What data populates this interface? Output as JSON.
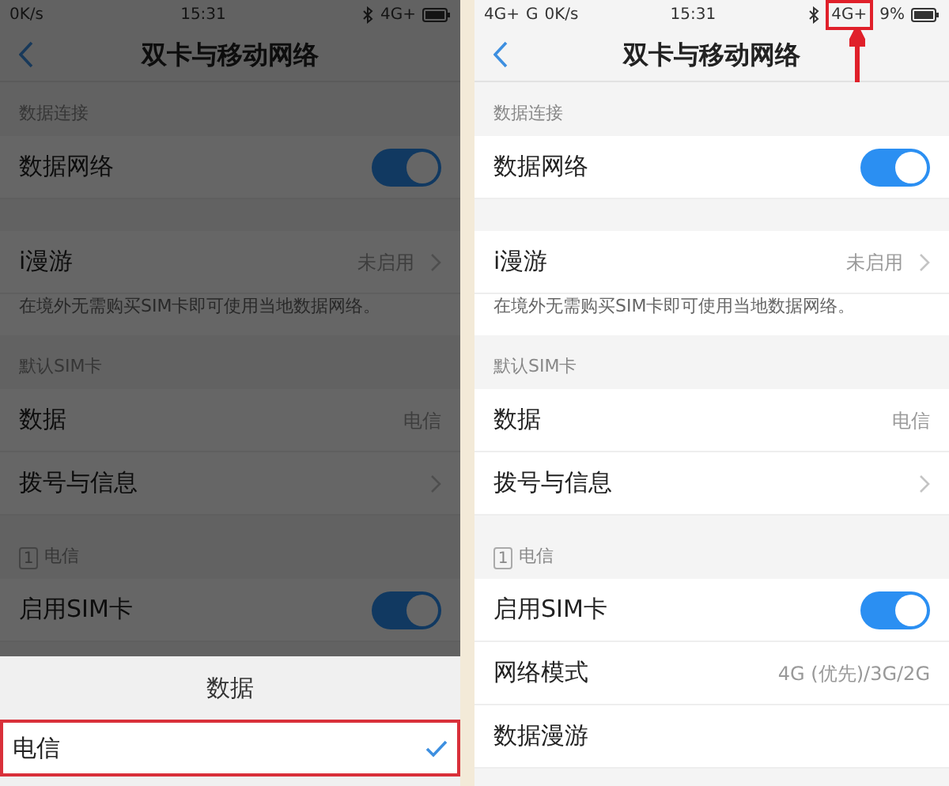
{
  "screens": [
    {
      "dimmed": true,
      "status_bar": {
        "left": [
          {
            "text": "0K/s",
            "boxed": false
          }
        ],
        "time": "15:31",
        "right": [
          {
            "text": "4G+",
            "boxed": false
          }
        ]
      },
      "title": "双卡与移动网络",
      "rows": [
        {
          "kind": "section",
          "label": "数据连接"
        },
        {
          "kind": "toggle",
          "label": "数据网络",
          "on": true
        },
        {
          "kind": "gap"
        },
        {
          "kind": "link",
          "label": "i漫游",
          "value": "未启用"
        },
        {
          "kind": "note",
          "label": "在境外无需购买SIM卡即可使用当地数据网络。"
        },
        {
          "kind": "section",
          "label": "默认SIM卡"
        },
        {
          "kind": "value",
          "label": "数据",
          "value": "电信"
        },
        {
          "kind": "link",
          "label": "拨号与信息",
          "value": ""
        },
        {
          "kind": "sim",
          "number": "1",
          "label": "电信"
        },
        {
          "kind": "toggle",
          "label": "启用SIM卡",
          "on": true
        }
      ],
      "sheet": {
        "title": "数据",
        "options": [
          {
            "label": "电信",
            "selected": true,
            "boxed": true
          }
        ]
      }
    },
    {
      "dimmed": false,
      "status_bar": {
        "left": [
          {
            "text": "4G+",
            "boxed": false
          },
          {
            "text": "G",
            "boxed": false
          },
          {
            "text": "0K/s",
            "boxed": false
          }
        ],
        "time": "15:31",
        "right": [
          {
            "text": "4G+",
            "boxed": true
          },
          {
            "text": "9%",
            "boxed": false
          }
        ]
      },
      "title": "双卡与移动网络",
      "rows": [
        {
          "kind": "section",
          "label": "数据连接"
        },
        {
          "kind": "toggle",
          "label": "数据网络",
          "on": true
        },
        {
          "kind": "gap"
        },
        {
          "kind": "link",
          "label": "i漫游",
          "value": "未启用"
        },
        {
          "kind": "note",
          "label": "在境外无需购买SIM卡即可使用当地数据网络。"
        },
        {
          "kind": "section",
          "label": "默认SIM卡"
        },
        {
          "kind": "value",
          "label": "数据",
          "value": "电信"
        },
        {
          "kind": "link",
          "label": "拨号与信息",
          "value": ""
        },
        {
          "kind": "sim",
          "number": "1",
          "label": "电信"
        },
        {
          "kind": "toggle",
          "label": "启用SIM卡",
          "on": true
        },
        {
          "kind": "value",
          "label": "网络模式",
          "value": "4G (优先)/3G/2G"
        },
        {
          "kind": "value",
          "label": "数据漫游",
          "value": ""
        }
      ]
    }
  ]
}
